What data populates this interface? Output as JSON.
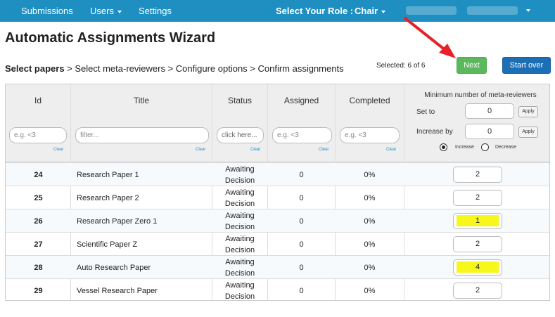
{
  "nav": {
    "submissions": "Submissions",
    "users": "Users",
    "settings": "Settings",
    "role_label": "Select Your Role :",
    "role_value": "Chair"
  },
  "page": {
    "title": "Automatic Assignments Wizard",
    "selected": "Selected: 6 of 6",
    "next": "Next",
    "start_over": "Start over"
  },
  "steps": {
    "current": "Select papers",
    "rest": " > Select meta-reviewers > Configure options > Confirm assignments"
  },
  "table": {
    "headers": {
      "id": "Id",
      "title": "Title",
      "status": "Status",
      "assigned": "Assigned",
      "completed": "Completed"
    },
    "filters": {
      "id": "e.g. <3",
      "title": "filter...",
      "status": "click here...",
      "assigned": "e.g. <3",
      "completed": "e.g. <3",
      "clear": "Clear"
    },
    "min_panel": {
      "title": "Minimum number of meta-reviewers",
      "set_to_label": "Set to",
      "set_to_value": "0",
      "increase_by_label": "Increase by",
      "increase_by_value": "0",
      "apply": "Apply",
      "increase": "Increase",
      "decrease": "Decrease"
    },
    "rows": [
      {
        "id": "24",
        "title": "Research Paper 1",
        "status": "Awaiting Decision",
        "assigned": "0",
        "completed": "0%",
        "min": "2"
      },
      {
        "id": "25",
        "title": "Research Paper 2",
        "status": "Awaiting Decision",
        "assigned": "0",
        "completed": "0%",
        "min": "2"
      },
      {
        "id": "26",
        "title": "Research Paper Zero 1",
        "status": "Awaiting Decision",
        "assigned": "0",
        "completed": "0%",
        "min": "1"
      },
      {
        "id": "27",
        "title": "Scientific Paper Z",
        "status": "Awaiting Decision",
        "assigned": "0",
        "completed": "0%",
        "min": "2"
      },
      {
        "id": "28",
        "title": "Auto Research Paper",
        "status": "Awaiting Decision",
        "assigned": "0",
        "completed": "0%",
        "min": "4"
      },
      {
        "id": "29",
        "title": "Vessel Research Paper",
        "status": "Awaiting Decision",
        "assigned": "0",
        "completed": "0%",
        "min": "2"
      }
    ]
  },
  "colors": {
    "navbar": "#1f8fc2",
    "next_button": "#5cb85c",
    "start_over_button": "#1d6fb5",
    "highlight": "#f7f71c",
    "arrow": "#e8202a"
  }
}
